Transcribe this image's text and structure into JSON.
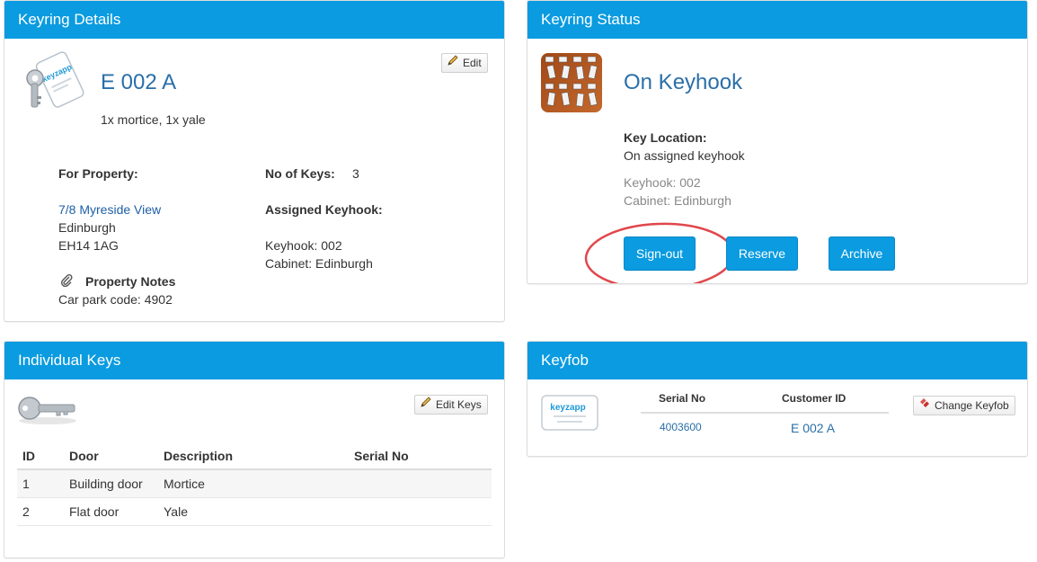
{
  "details": {
    "heading": "Keyring Details",
    "edit_label": "Edit",
    "keyring_name": "E 002 A",
    "keys_summary": "1x mortice, 1x yale",
    "for_property_label": "For Property:",
    "property_address_1": "7/8 Myreside View",
    "property_city": "Edinburgh",
    "property_postcode": "EH14 1AG",
    "property_notes_label": "Property Notes",
    "property_notes_value": "Car park code: 4902",
    "no_of_keys_label": "No of Keys:",
    "no_of_keys_value": "3",
    "assigned_keyhook_label": "Assigned Keyhook:",
    "assigned_keyhook": "Keyhook: 002",
    "assigned_cabinet": "Cabinet: Edinburgh"
  },
  "status": {
    "heading": "Keyring Status",
    "state": "On Keyhook",
    "key_location_label": "Key Location:",
    "key_location_value": "On assigned keyhook",
    "keyhook": "Keyhook: 002",
    "cabinet": "Cabinet: Edinburgh",
    "buttons": {
      "signout": "Sign-out",
      "reserve": "Reserve",
      "archive": "Archive"
    }
  },
  "keys": {
    "heading": "Individual Keys",
    "edit_keys_label": "Edit Keys",
    "columns": [
      "ID",
      "Door",
      "Description",
      "Serial No"
    ],
    "rows": [
      {
        "id": "1",
        "door": "Building door",
        "description": "Mortice",
        "serial": ""
      },
      {
        "id": "2",
        "door": "Flat door",
        "description": "Yale",
        "serial": ""
      }
    ]
  },
  "keyfob": {
    "heading": "Keyfob",
    "serial_label": "Serial No",
    "customer_label": "Customer ID",
    "serial_value": "4003600",
    "customer_value": "E 002 A",
    "change_label": "Change Keyfob",
    "brand": "keyzapp"
  },
  "colors": {
    "header_blue": "#0a9be0",
    "title_blue": "#2a6fa8",
    "highlight_red": "#e0474c"
  }
}
